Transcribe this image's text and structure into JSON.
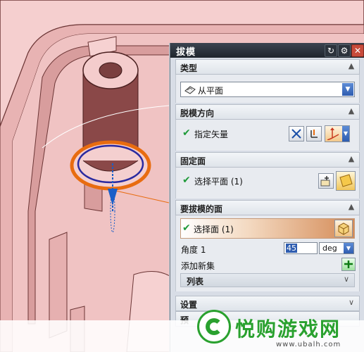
{
  "dialog": {
    "title": "拔模",
    "buttons": {
      "reset_icon": "reset-icon",
      "settings_icon": "gear-icon",
      "close_icon": "close-icon"
    }
  },
  "sections": {
    "type": {
      "title": "类型",
      "selected": "从平面"
    },
    "direction": {
      "title": "脱模方向",
      "row_label": "指定矢量"
    },
    "fixed_face": {
      "title": "固定面",
      "row_label": "选择平面 (1)"
    },
    "faces_to_draft": {
      "title": "要拔模的面",
      "row_label": "选择面 (1)",
      "angle_label": "角度 1",
      "angle_value": "45",
      "angle_unit": "deg",
      "add_set_label": "添加新集",
      "list_label": "列表"
    },
    "settings": {
      "title": "设置"
    },
    "preview": {
      "title": "预"
    }
  },
  "watermark": {
    "brand_text": "悦购游戏网",
    "url": "www.ubalh.com"
  },
  "colors": {
    "model_body": "#f2c2c2",
    "model_shadow": "#7a3f3f",
    "highlight_ring": "#e86c10",
    "dialog_bg": "#d8dde6",
    "accent_blue": "#2f5db0",
    "watermark_green": "#2aa12f"
  }
}
